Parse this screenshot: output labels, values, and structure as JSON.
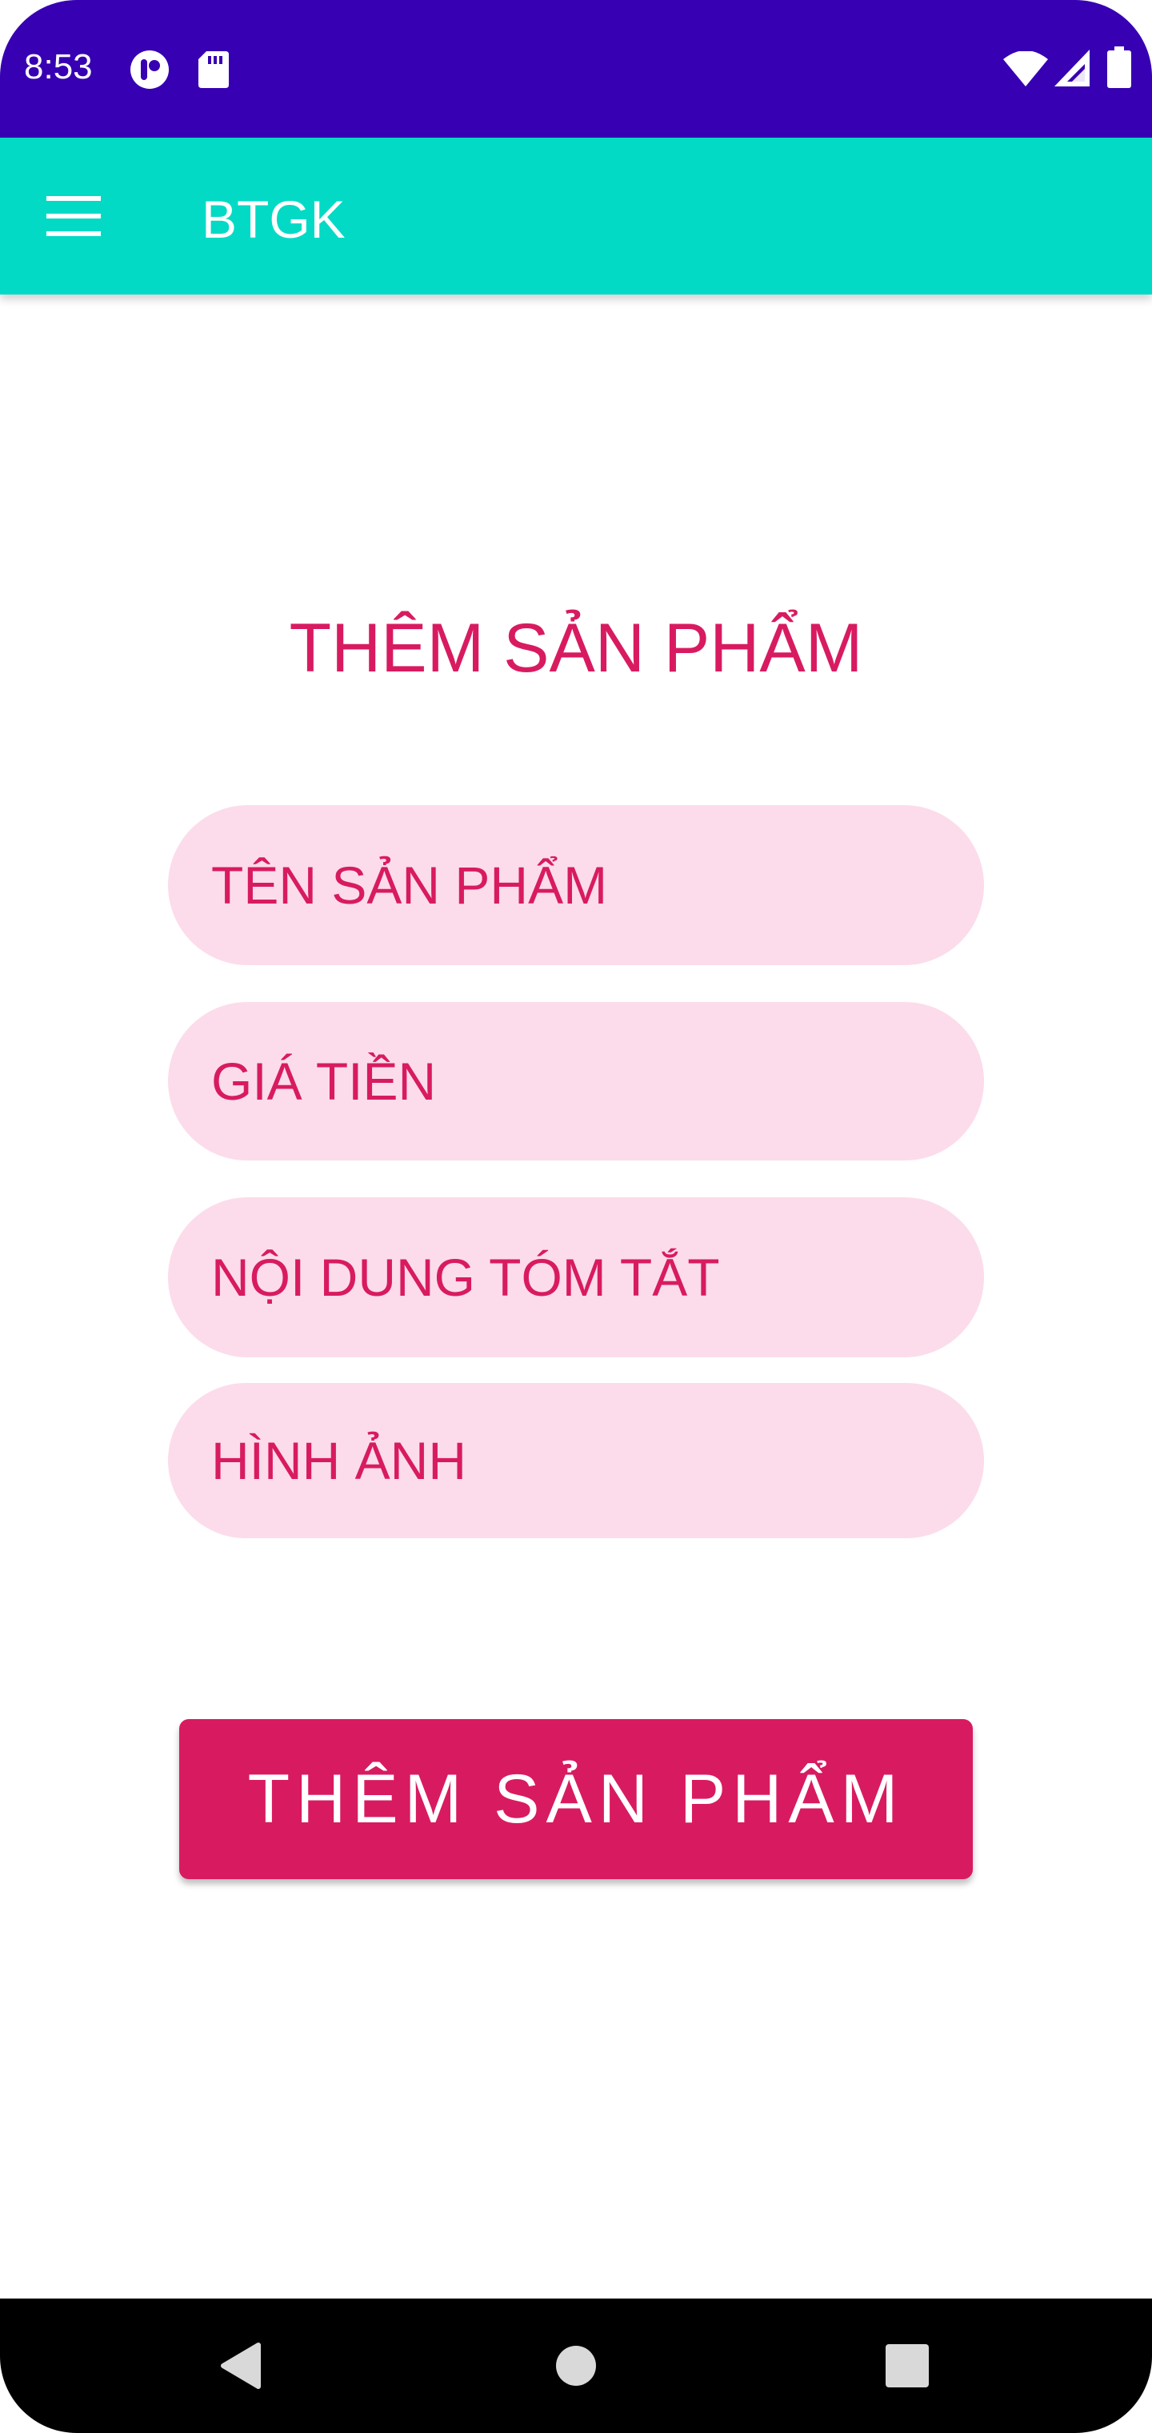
{
  "status_bar": {
    "time": "8:53",
    "icons": [
      "notification-app-icon",
      "sd-card-icon",
      "wifi-icon",
      "signal-icon",
      "battery-icon"
    ],
    "background_color": "#3700b3"
  },
  "toolbar": {
    "title": "BTGK",
    "menu_icon": "hamburger-menu-icon",
    "background_color": "#03dac5"
  },
  "form": {
    "heading": "THÊM SẢN PHẨM",
    "fields": [
      {
        "placeholder": "TÊN SẢN PHẨM",
        "value": ""
      },
      {
        "placeholder": "GIÁ TIỀN",
        "value": ""
      },
      {
        "placeholder": "NỘI DUNG TÓM TẮT",
        "value": ""
      },
      {
        "placeholder": "HÌNH ẢNH",
        "value": ""
      }
    ],
    "submit_label": "THÊM SẢN PHẨM",
    "accent_color": "#d81b60",
    "field_background": "#fcdcea"
  },
  "nav_bar": {
    "buttons": [
      "back-icon",
      "home-icon",
      "recents-icon"
    ]
  }
}
